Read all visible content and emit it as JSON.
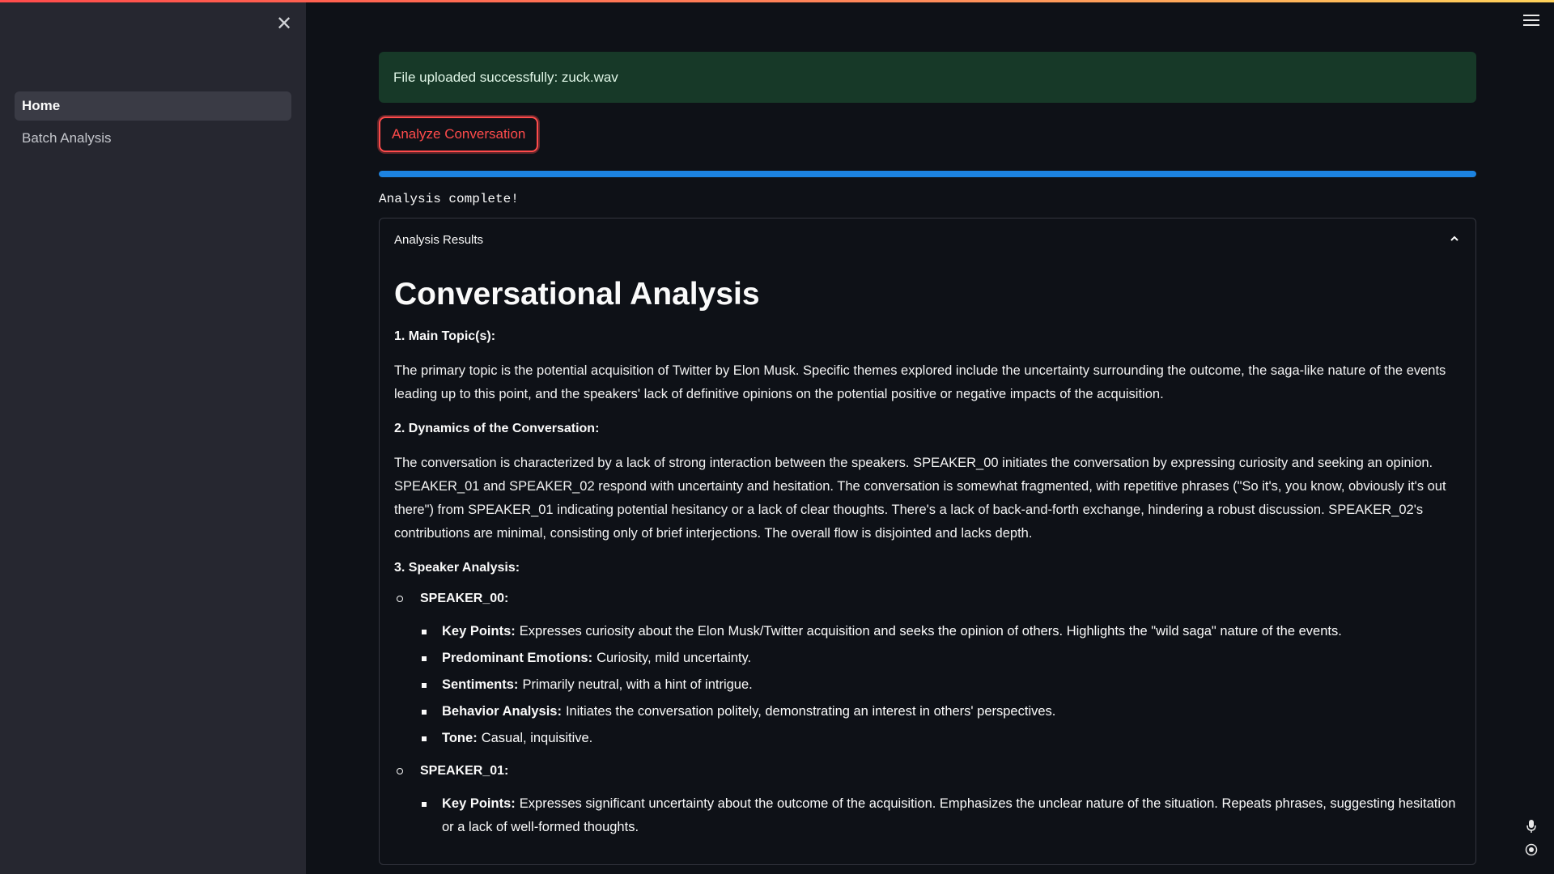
{
  "sidebar": {
    "items": [
      {
        "label": "Home",
        "active": true
      },
      {
        "label": "Batch Analysis",
        "active": false
      }
    ]
  },
  "alert": {
    "text": "File uploaded successfully: zuck.wav"
  },
  "analyze_button": {
    "label": "Analyze Conversation"
  },
  "progress": {
    "value": 1.0
  },
  "status_text": "Analysis complete!",
  "expander": {
    "title": "Analysis Results",
    "heading": "Conversational Analysis",
    "sections": [
      {
        "title": "1. Main Topic(s):",
        "paragraph": "The primary topic is the potential acquisition of Twitter by Elon Musk. Specific themes explored include the uncertainty surrounding the outcome, the saga-like nature of the events leading up to this point, and the speakers' lack of definitive opinions on the potential positive or negative impacts of the acquisition."
      },
      {
        "title": "2. Dynamics of the Conversation:",
        "paragraph": "The conversation is characterized by a lack of strong interaction between the speakers. SPEAKER_00 initiates the conversation by expressing curiosity and seeking an opinion. SPEAKER_01 and SPEAKER_02 respond with uncertainty and hesitation. The conversation is somewhat fragmented, with repetitive phrases (\"So it's, you know, obviously it's out there\") from SPEAKER_01 indicating potential hesitancy or a lack of clear thoughts. There's a lack of back-and-forth exchange, hindering a robust discussion. SPEAKER_02's contributions are minimal, consisting only of brief interjections. The overall flow is disjointed and lacks depth."
      },
      {
        "title": "3. Speaker Analysis:"
      }
    ],
    "speakers": [
      {
        "name": "SPEAKER_00:",
        "points": [
          {
            "label": "Key Points:",
            "text": "Expresses curiosity about the Elon Musk/Twitter acquisition and seeks the opinion of others. Highlights the \"wild saga\" nature of the events."
          },
          {
            "label": "Predominant Emotions:",
            "text": "Curiosity, mild uncertainty."
          },
          {
            "label": "Sentiments:",
            "text": "Primarily neutral, with a hint of intrigue."
          },
          {
            "label": "Behavior Analysis:",
            "text": "Initiates the conversation politely, demonstrating an interest in others' perspectives."
          },
          {
            "label": "Tone:",
            "text": "Casual, inquisitive."
          }
        ]
      },
      {
        "name": "SPEAKER_01:",
        "points": [
          {
            "label": "Key Points:",
            "text": "Expresses significant uncertainty about the outcome of the acquisition. Emphasizes the unclear nature of the situation. Repeats phrases, suggesting hesitation or a lack of well-formed thoughts."
          }
        ]
      }
    ]
  },
  "icons": {
    "close": "close-icon",
    "menu": "hamburger-menu-icon",
    "chevron": "chevron-up-icon",
    "mic": "microphone-icon",
    "record": "record-icon"
  },
  "colors": {
    "background": "#0e1117",
    "sidebar": "#262730",
    "accent": "#ff4b4b",
    "progress": "#1c83e1",
    "success_bg": "#173928"
  }
}
